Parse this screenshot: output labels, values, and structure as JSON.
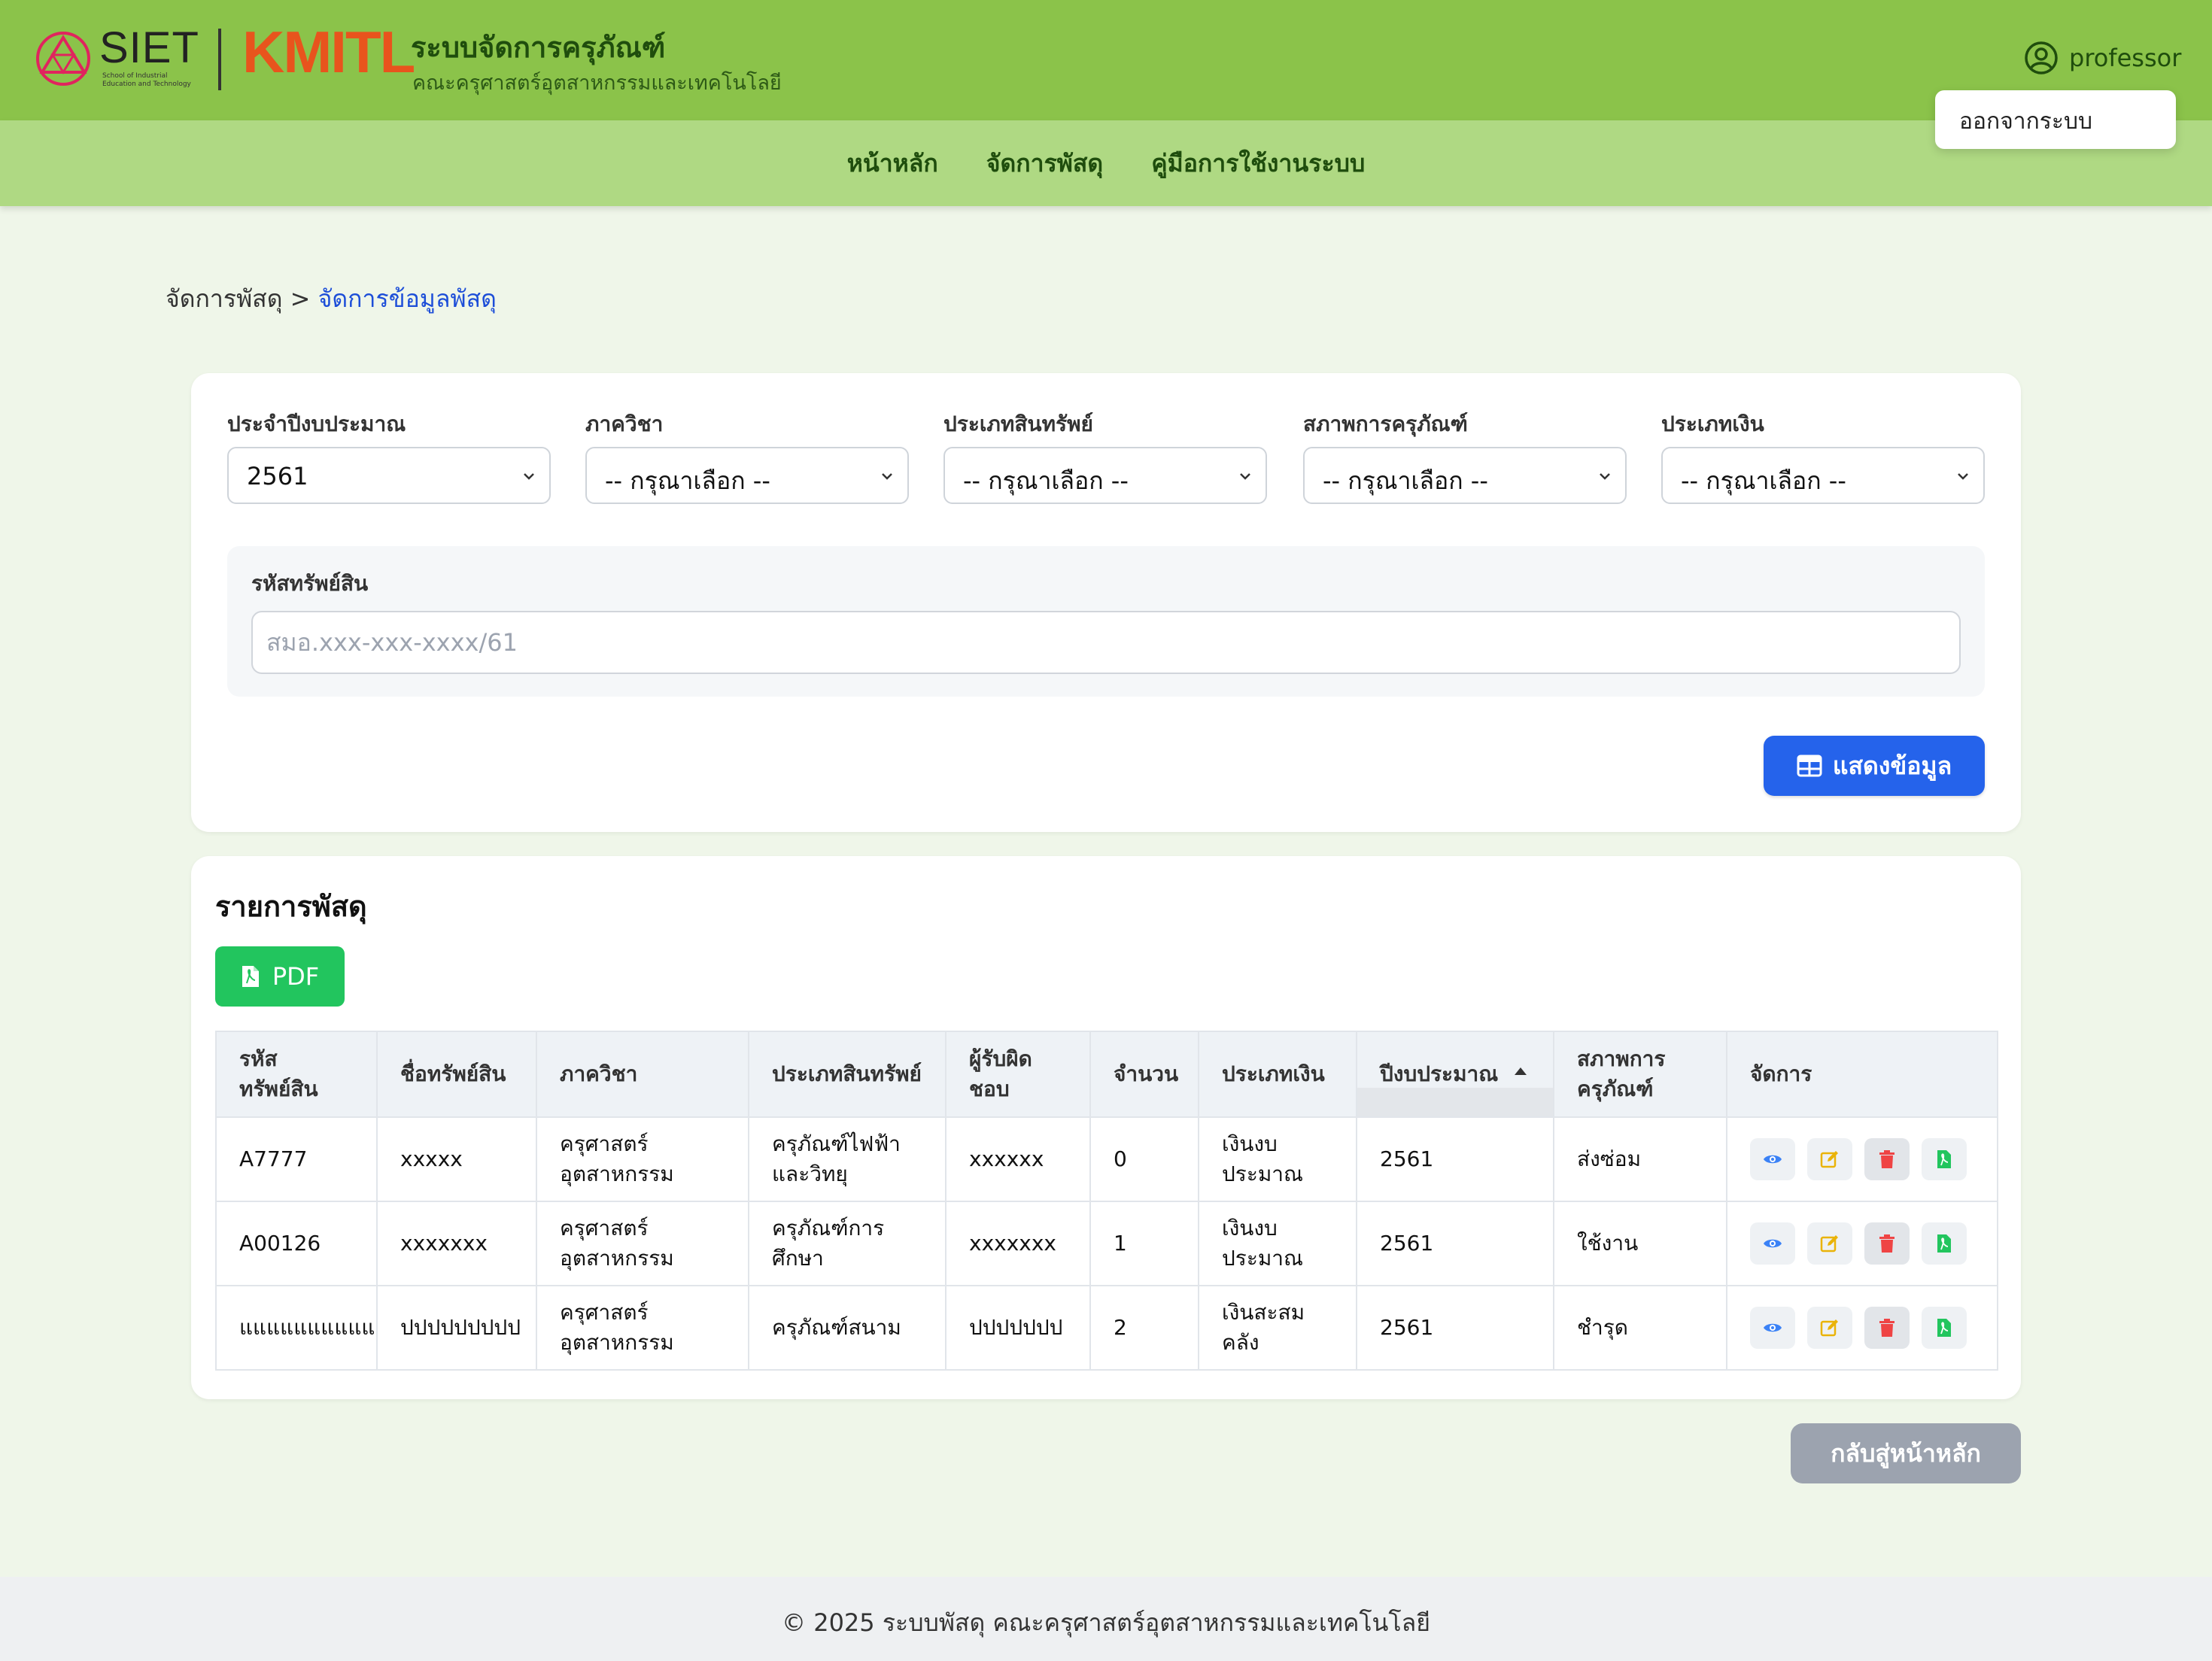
{
  "header": {
    "logo_siet_word": "SIET",
    "logo_siet_sub": "School of Industrial Education and Technology",
    "logo_kmitl": "KMITL",
    "title": "ระบบจัดการครุภัณฑ์",
    "subtitle": "คณะครุศาสตร์อุตสาหกรรมและเทคโนโลยี",
    "user": "professor",
    "user_menu": {
      "logout": "ออกจากระบบ"
    }
  },
  "nav": [
    {
      "label": "หน้าหลัก"
    },
    {
      "label": "จัดการพัสดุ"
    },
    {
      "label": "คู่มือการใช้งานระบบ"
    }
  ],
  "breadcrumb": {
    "parent": "จัดการพัสดุ",
    "separator": ">",
    "current": "จัดการข้อมูลพัสดุ"
  },
  "filters": [
    {
      "label": "ประจำปีงบประมาณ",
      "value": "2561"
    },
    {
      "label": "ภาควิชา",
      "value": "-- กรุณาเลือก --"
    },
    {
      "label": "ประเภทสินทรัพย์",
      "value": "-- กรุณาเลือก --"
    },
    {
      "label": "สภาพการครุภัณฑ์",
      "value": "-- กรุณาเลือก --"
    },
    {
      "label": "ประเภทเงิน",
      "value": "-- กรุณาเลือก --"
    }
  ],
  "asset_code": {
    "label": "รหัสทรัพย์สิน",
    "placeholder": "สมอ.xxx-xxx-xxxx/61",
    "value": ""
  },
  "show_button": "แสดงข้อมูล",
  "table_section": {
    "title": "รายการพัสดุ",
    "pdf_button": "PDF",
    "columns": [
      "รหัส ทรัพย์สิน",
      "ชื่อทรัพย์สิน",
      "ภาควิชา",
      "ประเภทสินทรัพย์",
      "ผู้รับผิด ชอบ",
      "จำนวน",
      "ประเภทเงิน",
      "ปีงบประมาณ",
      "สภาพการ ครุภัณฑ์",
      "จัดการ"
    ],
    "sorted_column": "ปีงบประมาณ",
    "sort_direction": "ascending",
    "rows": [
      [
        "A7777",
        "xxxxx",
        "ครุศาสตร์ อุตสาหกรรม",
        "ครุภัณฑ์ไฟฟ้า และวิทยุ",
        "xxxxxx",
        "0",
        "เงินงบ ประมาณ",
        "2561",
        "ส่งซ่อม"
      ],
      [
        "A00126",
        "xxxxxxx",
        "ครุศาสตร์ อุตสาหกรรม",
        "ครุภัณฑ์การ ศึกษา",
        "xxxxxxx",
        "1",
        "เงินงบ ประมาณ",
        "2561",
        "ใช้งาน"
      ],
      [
        "แแแแแแแแแแ",
        "ปปปปปปปปป",
        "ครุศาสตร์ อุตสาหกรรม",
        "ครุภัณฑ์สนาม",
        "ปปปปปปป",
        "2",
        "เงินสะสม คลัง",
        "2561",
        "ชำรุด"
      ]
    ],
    "row_actions": [
      "eye-icon",
      "edit-icon",
      "trash-icon",
      "file-pdf-icon"
    ]
  },
  "back_button": "กลับสู่หน้าหลัก",
  "footer": "© 2025 ระบบพัสดุ คณะครุศาสตร์อุตสาหกรรมและเทคโนโลยี",
  "colors": {
    "header": "#8bc34a",
    "navbar": "#afd983",
    "page_bg": "#eff6e9",
    "primary": "#2563eb",
    "pdf_green": "#22c55e",
    "view_blue": "#3b82f6",
    "edit_yellow": "#eab308",
    "delete_red": "#ef4444",
    "back_gray": "#9ca3af"
  }
}
